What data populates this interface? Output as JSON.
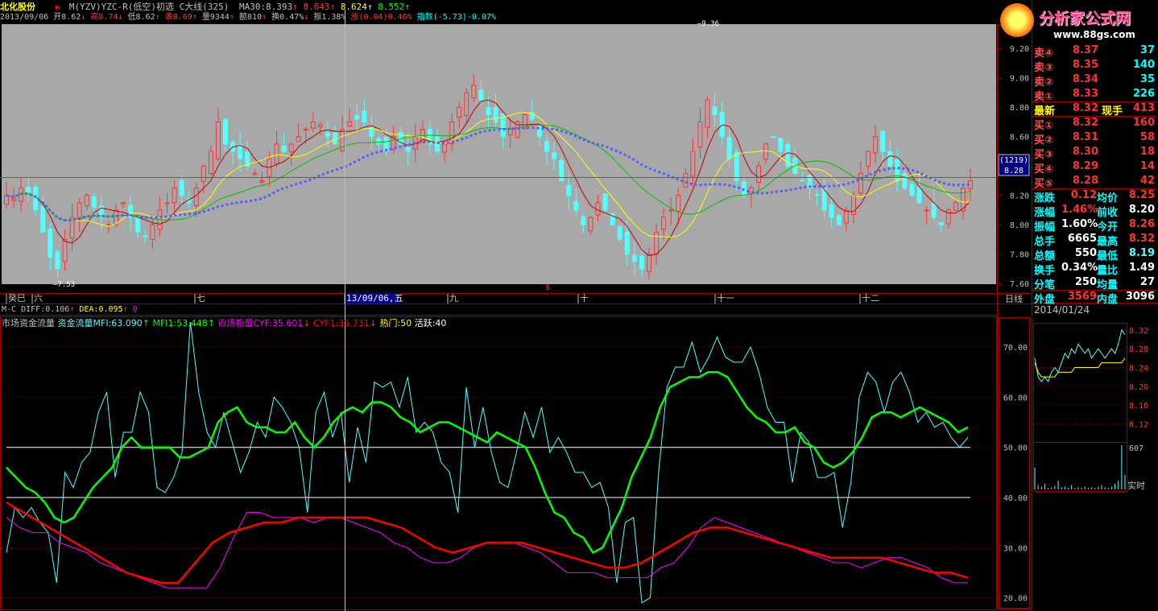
{
  "header": {
    "stock_name": "北化股份",
    "formula": "M(YZV)YZC-R(低空)初选 C大线(325)",
    "ma30": "MA30:8.393",
    "ma30_v1": "8.643",
    "ma30_v2": "8.624",
    "ma30_v3": "8.552"
  },
  "info": {
    "date": "2013/09/06",
    "open": "开8.62",
    "high": "高8.74",
    "low": "低8.62",
    "close": "收8.69",
    "volume": "量9344",
    "amount": "额810",
    "turnover": "换0.47%",
    "amplitude": "振1.38%",
    "change": "涨(0.04)0.46%",
    "index": "指数(-5.73)-0.07%"
  },
  "price_axis": {
    "ticks": [
      "9.20",
      "9.00",
      "8.80",
      "8.60",
      "8.40",
      "8.20",
      "8.00",
      "7.80",
      "7.60"
    ],
    "cursor_box": "(1219)",
    "cursor_price": "8.28",
    "hi_label": "9.36",
    "lo_label": "7.53"
  },
  "time_axis": {
    "labels": [
      "癸巳",
      "六",
      "七",
      "13/09/06,五",
      "九",
      "十",
      "十一",
      "十二"
    ],
    "period": "日线"
  },
  "indicator1": {
    "title": "M-C",
    "diff": "DIFF:0.106",
    "dea": "DEA:0.095",
    "extra": "0"
  },
  "indicator2": {
    "title": "市场资金流量",
    "mfi": "资金流量MFI:63.090",
    "mfi1": "MFI1:53.448",
    "cyf": "市场能量CYF:35.601",
    "cyf1": "CYF1:35.731",
    "hot": "热门:50",
    "active": "活跃:40",
    "ticks": [
      "70.00",
      "60.00",
      "50.00",
      "40.00",
      "30.00",
      "20.00"
    ]
  },
  "quote": {
    "sell": [
      {
        "label": "卖④",
        "price": "8.37",
        "vol": "37"
      },
      {
        "label": "卖③",
        "price": "8.35",
        "vol": "140"
      },
      {
        "label": "卖②",
        "price": "8.34",
        "vol": "35"
      },
      {
        "label": "卖①",
        "price": "8.33",
        "vol": "226"
      }
    ],
    "latest": {
      "label": "最新",
      "price": "8.32",
      "lab2": "现手",
      "vol": "413"
    },
    "buy": [
      {
        "label": "买①",
        "price": "8.32",
        "vol": "160"
      },
      {
        "label": "买②",
        "price": "8.31",
        "vol": "58"
      },
      {
        "label": "买③",
        "price": "8.30",
        "vol": "18"
      },
      {
        "label": "买④",
        "price": "8.29",
        "vol": "14"
      },
      {
        "label": "买⑤",
        "price": "8.28",
        "vol": "42"
      }
    ],
    "stats": [
      {
        "l1": "涨跌",
        "v1": "0.12",
        "l2": "均价",
        "v2": "8.25"
      },
      {
        "l1": "涨幅",
        "v1": "1.46%",
        "l2": "前收",
        "v2": "8.20"
      },
      {
        "l1": "振幅",
        "v1": "1.60%",
        "l2": "今开",
        "v2": "8.26"
      },
      {
        "l1": "总手",
        "v1": "6665",
        "l2": "最高",
        "v2": "8.32"
      },
      {
        "l1": "总额",
        "v1": "550",
        "l2": "最低",
        "v2": "8.19"
      },
      {
        "l1": "换手",
        "v1": "0.34%",
        "l2": "量比",
        "v2": "1.49"
      },
      {
        "l1": "分笔",
        "v1": "250",
        "l2": "均量",
        "v2": "27"
      }
    ],
    "outer": {
      "l1": "外盘",
      "v1": "3569",
      "l2": "内盘",
      "v2": "3096"
    }
  },
  "mini": {
    "date": "2014/01/24",
    "ticks": [
      "8.32",
      "8.28",
      "8.24",
      "8.20",
      "8.16",
      "8.12"
    ],
    "vol_max": "607",
    "label": "实时"
  },
  "logo": {
    "title": "分析家公式网",
    "url": "www.88gs.com"
  },
  "colors": {
    "bg_main": "#a8a8a8",
    "up": "#ff3232",
    "down": "#54ffff",
    "mfi": "#54ffff",
    "mfi1": "#00ff00",
    "cyf": "#ff00ff",
    "cyf1": "#ff0000"
  },
  "chart_data": {
    "type": "line",
    "title": "市场资金流量",
    "ylim": [
      18,
      75
    ],
    "series": [
      {
        "name": "资金流量MFI",
        "values": [
          29,
          38,
          36,
          38,
          35,
          33,
          23,
          45,
          42,
          47,
          49,
          57,
          61,
          44,
          53,
          53,
          61,
          57,
          42,
          41,
          44,
          49,
          75,
          61,
          53,
          50,
          57,
          51,
          45,
          49,
          55,
          52,
          60,
          58,
          55,
          50,
          37,
          57,
          61,
          52,
          57,
          43,
          54,
          47,
          63,
          62,
          63,
          58,
          64,
          53,
          55,
          53,
          47,
          45,
          37,
          62,
          50,
          58,
          49,
          43,
          42,
          49,
          57,
          52,
          58,
          49,
          52,
          49,
          45,
          45,
          42,
          43,
          38,
          23,
          35,
          36,
          19,
          20,
          45,
          62,
          66,
          66,
          71,
          65,
          68,
          72,
          68,
          67,
          67,
          70,
          65,
          58,
          55,
          55,
          43,
          53,
          51,
          44,
          44,
          45,
          34,
          43,
          60,
          65,
          63,
          57,
          63,
          65,
          61,
          55,
          57,
          54,
          55,
          52,
          50,
          52
        ]
      },
      {
        "name": "MFI1",
        "values": [
          46,
          44,
          42,
          41,
          39,
          36,
          35,
          36,
          39,
          42,
          44,
          46,
          50,
          52,
          50,
          50,
          50,
          50,
          48,
          48,
          49,
          50,
          55,
          57,
          58,
          55,
          54,
          54,
          53,
          53,
          55,
          52,
          50,
          52,
          55,
          57,
          58,
          57,
          59,
          59,
          58,
          56,
          55,
          53,
          54,
          55,
          55,
          54,
          53,
          52,
          51,
          53,
          52,
          51,
          50,
          46,
          41,
          37,
          36,
          33,
          32,
          29,
          30,
          34,
          38,
          44,
          48,
          52,
          58,
          62,
          63,
          64,
          64,
          65,
          65,
          64,
          61,
          58,
          56,
          55,
          53,
          53,
          54,
          51,
          50,
          47,
          46,
          47,
          49,
          52,
          56,
          57,
          57,
          56,
          57,
          58,
          57,
          56,
          55,
          53,
          54
        ]
      },
      {
        "name": "市场能量CYF",
        "values": [
          36,
          34,
          33,
          33,
          31,
          30,
          29,
          27,
          26,
          25,
          24,
          23,
          22,
          22,
          22,
          22,
          26,
          32,
          37,
          37,
          36,
          36,
          36,
          35,
          36,
          36,
          35,
          34,
          33,
          31,
          30,
          28,
          27,
          27,
          28,
          30,
          31,
          31,
          31,
          30,
          29,
          27,
          25,
          25,
          25,
          24,
          24,
          24,
          24,
          26,
          27,
          30,
          34,
          36,
          35,
          34,
          33,
          32,
          31,
          30,
          29,
          28,
          27,
          27,
          26,
          27,
          28,
          28,
          27,
          26,
          24,
          23,
          23
        ]
      },
      {
        "name": "CYF1",
        "values": [
          39,
          37,
          35,
          33,
          31,
          29,
          27,
          25,
          24,
          23,
          23,
          27,
          31,
          33,
          34,
          35,
          35,
          36,
          36,
          36,
          36,
          36,
          35,
          34,
          32,
          30,
          29,
          30,
          31,
          31,
          31,
          30,
          29,
          28,
          27,
          26,
          26,
          27,
          29,
          31,
          33,
          34,
          34,
          33,
          32,
          31,
          30,
          29,
          28,
          28,
          28,
          28,
          27,
          26,
          25,
          25,
          24
        ]
      },
      {
        "name": "热门",
        "values": [
          50
        ]
      },
      {
        "name": "活跃",
        "values": [
          40
        ]
      }
    ]
  }
}
